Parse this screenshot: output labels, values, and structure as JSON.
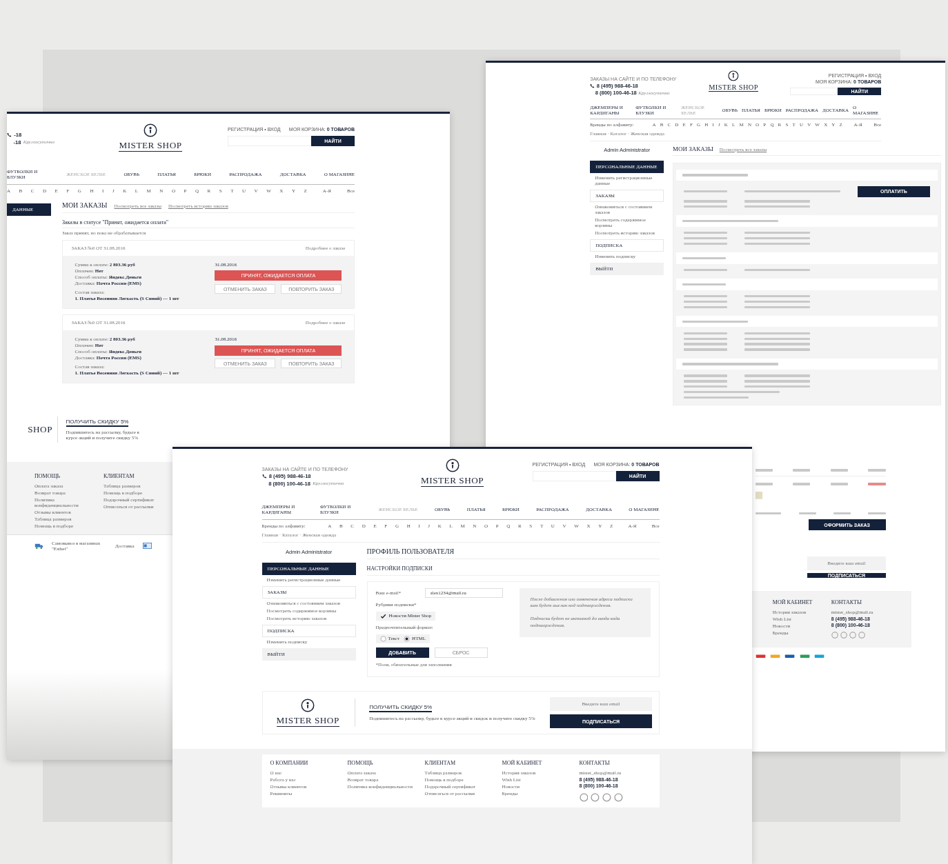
{
  "back_left_page": {
    "header": {
      "phones": [
        "-18",
        "-18"
      ],
      "hours": "Круглосуточно",
      "logo": "MISTER SHOP",
      "auth": "РЕГИСТРАЦИЯ • ВХОД",
      "cart": "МОЯ КОРЗИНА: **0 ТОВАРОВ**",
      "search_button": "НАЙТИ"
    },
    "nav": [
      {
        "label": "ФУТБОЛКИ И БЛУЗКИ",
        "dimmed": false
      },
      {
        "label": "ЖЕНСКОЕ БЕЛЬЕ",
        "dimmed": true
      },
      {
        "label": "ОБУВЬ",
        "dimmed": false
      },
      {
        "label": "ПЛАТЬЯ",
        "dimmed": false
      },
      {
        "label": "БРЮКИ",
        "dimmed": false
      },
      {
        "label": "РАСПРОДАЖА",
        "dimmed": false
      },
      {
        "label": "ДОСТАВКА",
        "dimmed": false
      },
      {
        "label": "О МАГАЗИНЕ",
        "dimmed": false
      }
    ],
    "letters": [
      "A",
      "B",
      "C",
      "D",
      "E",
      "F",
      "G",
      "H",
      "I",
      "J",
      "K",
      "L",
      "M",
      "N",
      "O",
      "P",
      "Q",
      "R",
      "S",
      "T",
      "U",
      "V",
      "W",
      "X",
      "Y",
      "Z"
    ],
    "extra_letters": [
      "А-Я",
      "Все"
    ],
    "sidebar_section": {
      "label": "ДАННЫЕ",
      "selected": true
    },
    "title": "МОИ ЗАКАЗЫ",
    "tabs": [
      "Посмотреть все заказы",
      "Посмотреть историю заказов"
    ],
    "status_title": "Заказы в статусе \"Принят, ожидается оплата\"",
    "status_note": "Заказ принят, но пока не обрабатывается",
    "orders": [
      {
        "number": "ЗАКАЗ №0 ОТ 31.08.2016",
        "details_link": "Подробнее о заказе",
        "lines": [
          {
            "label": "Сумма к оплате:",
            "value": "2 803.36 руб"
          },
          {
            "label": "Оплачен:",
            "value": "Нет"
          },
          {
            "label": "Способ оплаты:",
            "value": "Яндекс.Деньги"
          },
          {
            "label": "Доставка:",
            "value": "Почта России (EMS)"
          }
        ],
        "composition_label": "Состав заказа:",
        "item": "1. Платье Весенняя Легкость (S Синий) — 1 шт",
        "date": "31.08.2016",
        "status": "ПРИНЯТ, ОЖИДАЕТСЯ ОПЛАТА",
        "cancel": "ОТМЕНИТЬ ЗАКАЗ",
        "repeat": "ПОВТОРИТЬ ЗАКАЗ"
      },
      {
        "number": "ЗАКАЗ №0 ОТ 31.08.2016",
        "details_link": "Подробнее о заказе",
        "lines": [
          {
            "label": "Сумма к оплате:",
            "value": "2 803.36 руб"
          },
          {
            "label": "Оплачен:",
            "value": "Нет"
          },
          {
            "label": "Способ оплаты:",
            "value": "Яндекс.Деньги"
          },
          {
            "label": "Доставка:",
            "value": "Почта России (EMS)"
          }
        ],
        "composition_label": "Состав заказа:",
        "item": "1. Платье Весенняя Легкость (S Синий) — 1 шт",
        "date": "31.08.2016",
        "status": "ПРИНЯТ, ОЖИДАЕТСЯ ОПЛАТА",
        "cancel": "ОТМЕНИТЬ ЗАКАЗ",
        "repeat": "ПОВТОРИТЬ ЗАКАЗ"
      }
    ],
    "promo": {
      "logo": "SHOP",
      "title": "ПОЛУЧИТЬ СКИДКУ 5%",
      "text": "Подпишитесь на рассылку, будьте в курсе акций и получите скидку 5%"
    },
    "footer": [
      {
        "title": "ПОМОЩЬ",
        "links": [
          "Оплата заказа",
          "Возврат товара",
          "Политика конфиденциальности",
          "Отзывы клиентов",
          "Таблица размеров",
          "Помощь в подборе"
        ]
      },
      {
        "title": "КЛИЕНТАМ",
        "links": [
          "Таблица размеров",
          "Помощь в подборе",
          "Подарочный сертификат",
          "Отписаться от рассылки"
        ]
      }
    ],
    "strip": {
      "pickup": "Самовывоз в магазинах \"Esthet\"",
      "delivery": "Доставка"
    }
  },
  "back_right_page": {
    "header": {
      "order_label": "ЗАКАЗЫ НА САЙТЕ И ПО ТЕЛЕФОНУ",
      "phones": [
        "8 (495) 988-46-18",
        "8 (800) 100-46-18"
      ],
      "hours": "Круглосуточно",
      "logo": "MISTER SHOP",
      "auth": "РЕГИСТРАЦИЯ • ВХОД",
      "cart": "МОЯ КОРЗИНА: **0 ТОВАРОВ**",
      "search_button": "НАЙТИ"
    },
    "nav": [
      {
        "label": "ДЖЕМПЕРЫ И КАРДИГАНЫ",
        "dimmed": false
      },
      {
        "label": "ФУТБОЛКИ И БЛУЗКИ",
        "dimmed": false
      },
      {
        "label": "ЖЕНСКОЕ БЕЛЬЕ",
        "dimmed": true
      },
      {
        "label": "ОБУВЬ",
        "dimmed": false
      },
      {
        "label": "ПЛАТЬЯ",
        "dimmed": false
      },
      {
        "label": "БРЮКИ",
        "dimmed": false
      },
      {
        "label": "РАСПРОДАЖА",
        "dimmed": false
      },
      {
        "label": "ДОСТАВКА",
        "dimmed": false
      },
      {
        "label": "О МАГАЗИНЕ",
        "dimmed": false
      }
    ],
    "alphabet_label": "Бренды по алфавиту:",
    "letters": [
      "A",
      "B",
      "C",
      "D",
      "E",
      "F",
      "G",
      "H",
      "I",
      "J",
      "K",
      "L",
      "M",
      "N",
      "O",
      "P",
      "Q",
      "R",
      "S",
      "T",
      "U",
      "V",
      "W",
      "X",
      "Y",
      "Z"
    ],
    "extra_letters": [
      "А-Я",
      "Все"
    ],
    "breadcrumb": "Главная · Каталог · Женская одежда",
    "sidebar": {
      "user": "Admin Administrator",
      "sections": [
        {
          "title": "ПЕРСОНАЛЬНЫЕ ДАННЫЕ",
          "kind": "section",
          "selected": true,
          "links": [
            "Изменить регистрационные данные"
          ]
        },
        {
          "title": "ЗАКАЗЫ",
          "kind": "section",
          "selected": false,
          "links": [
            "Ознакомиться с состоянием заказов",
            "Посмотреть содержимое корзины",
            "Посмотреть историю заказов"
          ]
        },
        {
          "title": "ПОДПИСКА",
          "kind": "section",
          "selected": false,
          "links": [
            "Изменить подписку"
          ]
        },
        {
          "title": "ВЫЙТИ",
          "kind": "logout",
          "selected": false
        }
      ]
    },
    "title": "МОИ ЗАКАЗЫ",
    "tabs": [
      "Посмотреть все заказы"
    ],
    "pay_button": "ОПЛАТИТЬ",
    "checkout_button": "ОФОРМИТЬ ЗАКАЗ",
    "subscribe": {
      "placeholder": "Введите ваш email",
      "button": "ПОДПИСАТЬСЯ"
    },
    "footer": [
      {
        "title": "МОЙ КАБИНЕТ",
        "kind": "links",
        "links": [
          "История заказов",
          "Wish List",
          "Новости",
          "Бренды"
        ]
      },
      {
        "title": "КОНТАКТЫ",
        "kind": "contacts",
        "links": [
          "mister_shop@mail.ru"
        ],
        "phones": [
          "8 (495) 988-46-18",
          "8 (800) 100-46-18"
        ]
      }
    ]
  },
  "front_page": {
    "header": {
      "order_label": "ЗАКАЗЫ НА САЙТЕ И ПО ТЕЛЕФОНУ",
      "phones": [
        "8 (495) 988-46-18",
        "8 (800) 100-46-18"
      ],
      "hours": "Круглосуточно",
      "logo": "MISTER SHOP",
      "auth": "РЕГИСТРАЦИЯ • ВХОД",
      "cart": "МОЯ КОРЗИНА: **0 ТОВАРОВ**",
      "search_button": "НАЙТИ"
    },
    "nav": [
      {
        "label": "ДЖЕМПЕРЫ И КАРДИГАНЫ",
        "dimmed": false
      },
      {
        "label": "ФУТБОЛКИ И БЛУЗКИ",
        "dimmed": false
      },
      {
        "label": "ЖЕНСКОЕ БЕЛЬЕ",
        "dimmed": true
      },
      {
        "label": "ОБУВЬ",
        "dimmed": false
      },
      {
        "label": "ПЛАТЬЯ",
        "dimmed": false
      },
      {
        "label": "БРЮКИ",
        "dimmed": false
      },
      {
        "label": "РАСПРОДАЖА",
        "dimmed": false
      },
      {
        "label": "ДОСТАВКА",
        "dimmed": false
      },
      {
        "label": "О МАГАЗИНЕ",
        "dimmed": false
      }
    ],
    "alphabet_label": "Бренды по алфавиту:",
    "letters": [
      "A",
      "B",
      "C",
      "D",
      "E",
      "F",
      "G",
      "H",
      "I",
      "J",
      "K",
      "L",
      "M",
      "N",
      "O",
      "P",
      "Q",
      "R",
      "S",
      "T",
      "U",
      "V",
      "W",
      "X",
      "Y",
      "Z"
    ],
    "extra_letters": [
      "А-Я",
      "Все"
    ],
    "breadcrumb": "Главная · Каталог · Женская одежда",
    "sidebar": {
      "user": "Admin Administrator",
      "sections": [
        {
          "title": "ПЕРСОНАЛЬНЫЕ ДАННЫЕ",
          "kind": "section",
          "selected": true,
          "links": [
            "Изменить регистрационные данные"
          ]
        },
        {
          "title": "ЗАКАЗЫ",
          "kind": "section",
          "selected": false,
          "links": [
            "Ознакомиться с состоянием заказов",
            "Посмотреть содержимое корзины",
            "Посмотреть историю заказов"
          ]
        },
        {
          "title": "ПОДПИСКА",
          "kind": "section",
          "selected": false,
          "links": [
            "Изменить подписку"
          ]
        },
        {
          "title": "ВЫЙТИ",
          "kind": "logout",
          "selected": false
        }
      ]
    },
    "title": "ПРОФИЛЬ ПОЛЬЗОВАТЕЛЯ",
    "form_title": "НАСТРОЙКИ ПОДПИСКИ",
    "form": {
      "email_label": "Ваш e-mail*",
      "email_value": "alex1234@mail.ru",
      "rubrics_label": "Рубрики подписки*",
      "rubrics": [
        {
          "label": "Новости Mister Shop",
          "checked": true
        }
      ],
      "format_label": "Предпочтительный формат:",
      "formats": [
        {
          "label": "Текст",
          "selected": false
        },
        {
          "label": "HTML",
          "selected": true
        }
      ],
      "submit": "ДОБАВИТЬ",
      "reset": "СБРОС",
      "required_note": "*Поля, обязательные для заполнения"
    },
    "note": [
      "После добавления или изменения адреса подписки вам будет выслан код подтверждения.",
      "Подписка будет не активной до ввода кода подтверждения."
    ],
    "promo": {
      "logo": "MISTER SHOP",
      "title": "ПОЛУЧИТЬ СКИДКУ 5%",
      "text": "Подпишитесь на рассылку, будьте в курсе акций и скидок и получите скидку 5%",
      "placeholder": "Введите ваш email",
      "button": "ПОДПИСАТЬСЯ"
    },
    "footer": [
      {
        "title": "О КОМПАНИИ",
        "kind": "links",
        "links": [
          "О нас",
          "Работа у нас",
          "Отзывы клиентов",
          "Реквизиты"
        ]
      },
      {
        "title": "ПОМОЩЬ",
        "kind": "links",
        "links": [
          "Оплата заказа",
          "Возврат товара",
          "Политика конфиденциальности"
        ]
      },
      {
        "title": "КЛИЕНТАМ",
        "kind": "links",
        "links": [
          "Таблица размеров",
          "Помощь в подборе",
          "Подарочный сертификат",
          "Отписаться от рассылки"
        ]
      },
      {
        "title": "МОЙ КАБИНЕТ",
        "kind": "links",
        "links": [
          "История заказов",
          "Wish List",
          "Новости",
          "Бренды"
        ]
      },
      {
        "title": "КОНТАКТЫ",
        "kind": "contacts",
        "links": [
          "mister_shop@mail.ru"
        ],
        "phones": [
          "8 (495) 988-46-18",
          "8 (800) 100-46-18"
        ]
      }
    ]
  }
}
